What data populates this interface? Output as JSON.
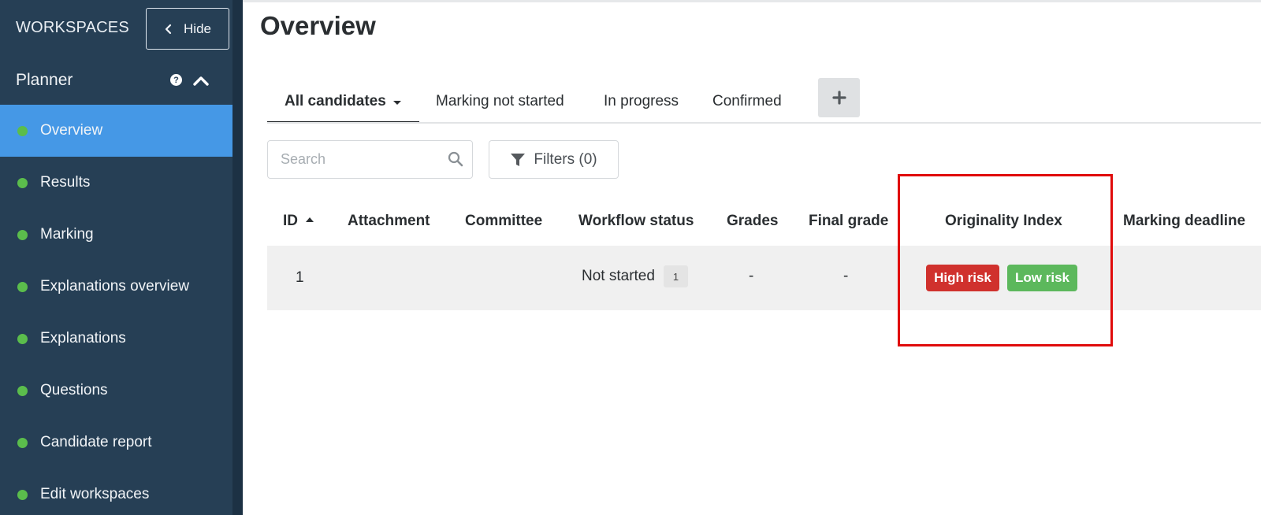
{
  "sidebar": {
    "workspaces_label": "WORKSPACES",
    "hide_label": "Hide",
    "section_title": "Planner",
    "help_glyph": "?",
    "items": [
      {
        "label": "Overview",
        "active": true
      },
      {
        "label": "Results"
      },
      {
        "label": "Marking"
      },
      {
        "label": "Explanations overview"
      },
      {
        "label": "Explanations"
      },
      {
        "label": "Questions"
      },
      {
        "label": "Candidate report"
      },
      {
        "label": "Edit workspaces"
      }
    ],
    "status_dot_color": "#5bbd4c",
    "active_color": "#4598e6",
    "background_color": "#263f55"
  },
  "main": {
    "title": "Overview",
    "tabs": [
      {
        "label": "All candidates",
        "active": true,
        "has_dropdown": true
      },
      {
        "label": "Marking not started"
      },
      {
        "label": "In progress"
      },
      {
        "label": "Confirmed"
      }
    ],
    "add_tab_icon": "plus-icon",
    "search": {
      "placeholder": "Search",
      "value": "",
      "icon": "search-icon"
    },
    "filters": {
      "label": "Filters (0)",
      "icon": "filter-icon"
    },
    "table": {
      "columns": [
        "ID",
        "Attachment",
        "Committee",
        "Workflow status",
        "Grades",
        "Final grade",
        "Originality Index",
        "Marking deadline"
      ],
      "sorted_column": "ID",
      "sort_direction": "ascending",
      "rows": [
        {
          "id": "1",
          "attachment": "",
          "committee": "",
          "workflow_status": "Not started",
          "workflow_count": "1",
          "grades": "-",
          "final_grade": "-",
          "originality": [
            {
              "label": "High risk",
              "color": "#d0312d"
            },
            {
              "label": "Low risk",
              "color": "#5cb85c"
            }
          ],
          "marking_deadline": ""
        }
      ]
    },
    "highlight_color": "#e00b0b"
  }
}
